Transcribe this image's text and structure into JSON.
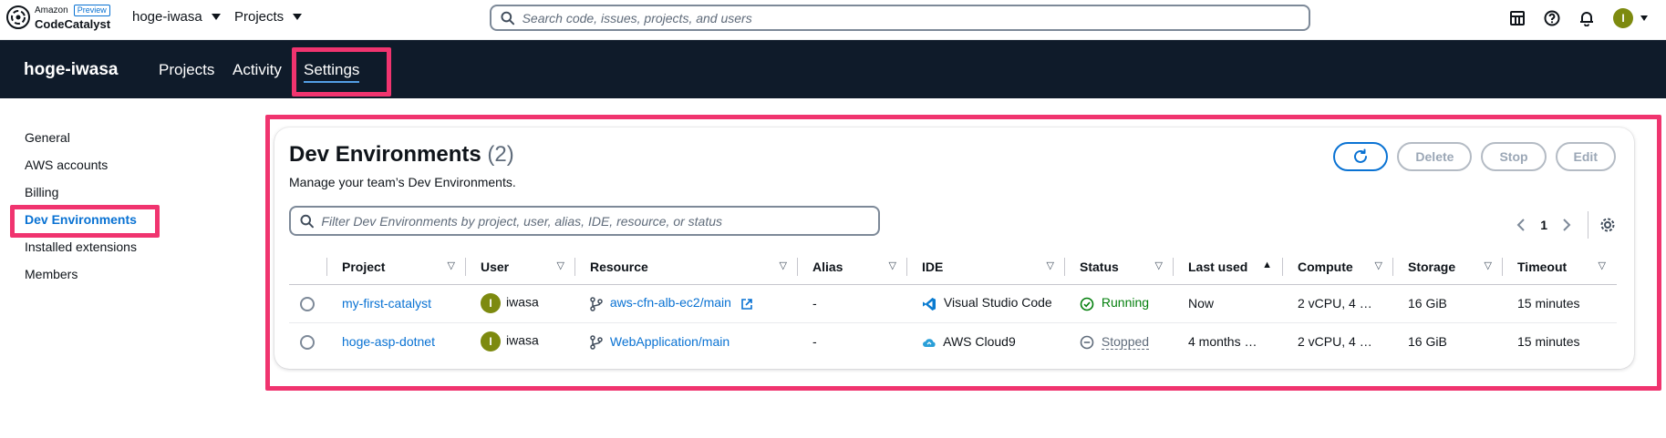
{
  "brand": {
    "amazon": "Amazon",
    "preview": "Preview",
    "name": "CodeCatalyst"
  },
  "topbar": {
    "space_menu": "hoge-iwasa",
    "projects_menu": "Projects",
    "search_placeholder": "Search code, issues, projects, and users",
    "avatar_initial": "I"
  },
  "nav": {
    "org": "hoge-iwasa",
    "links": [
      "Projects",
      "Activity",
      "Settings"
    ],
    "active": "Settings"
  },
  "sidebar": {
    "items": [
      "General",
      "AWS accounts",
      "Billing",
      "Dev Environments",
      "Installed extensions",
      "Members"
    ],
    "active": "Dev Environments"
  },
  "panel": {
    "title": "Dev Environments",
    "count": "(2)",
    "description": "Manage your team’s Dev Environments.",
    "buttons": {
      "delete": "Delete",
      "stop": "Stop",
      "edit": "Edit"
    },
    "filter_placeholder": "Filter Dev Environments by project, user, alias, IDE, resource, or status",
    "page": "1"
  },
  "table": {
    "columns": [
      "Project",
      "User",
      "Resource",
      "Alias",
      "IDE",
      "Status",
      "Last used",
      "Compute",
      "Storage",
      "Timeout"
    ],
    "rows": [
      {
        "project": "my-first-catalyst",
        "user_initial": "I",
        "user": "iwasa",
        "resource": "aws-cfn-alb-ec2/main",
        "alias": "-",
        "ide": "Visual Studio Code",
        "status": "Running",
        "last_used": "Now",
        "compute": "2 vCPU, 4 …",
        "storage": "16 GiB",
        "timeout": "15 minutes"
      },
      {
        "project": "hoge-asp-dotnet",
        "user_initial": "I",
        "user": "iwasa",
        "resource": "WebApplication/main",
        "alias": "-",
        "ide": "AWS Cloud9",
        "status": "Stopped",
        "last_used": "4 months …",
        "compute": "2 vCPU, 4 …",
        "storage": "16 GiB",
        "timeout": "15 minutes"
      }
    ]
  },
  "colors": {
    "highlight": "#f0346f",
    "link": "#0972d3",
    "nav_bg": "#0f1b2a",
    "running": "#037f0c"
  }
}
